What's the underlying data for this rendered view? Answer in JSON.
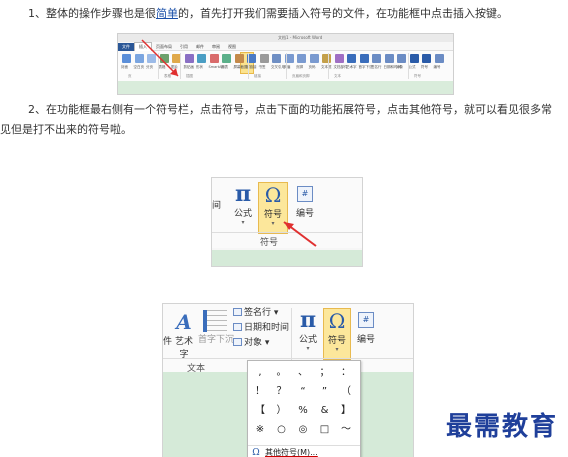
{
  "paragraphs": {
    "p1_before": "1、整体的操作步骤也是很",
    "p1_link": "简单",
    "p1_after": "的，首先打开我们需要插入符号的文件，在功能框中点击插入按键。",
    "p2": "2、在功能框最右侧有一个符号栏，点击符号，点击下面的功能拓展符号，点击其他符号，就可以看见很多常见但是打不出来的符号啦。"
  },
  "shot1": {
    "window_title": "文档1 - Microsoft Word",
    "file_tab": "文件",
    "tabs": [
      "插入",
      "页面布局",
      "引用",
      "邮件",
      "审阅",
      "视图"
    ],
    "active_tab": "插入",
    "ribbon_labels": [
      "封面",
      "空白页",
      "分页",
      "表格",
      "图片",
      "剪贴画",
      "形状",
      "SmartArt",
      "图表",
      "屏幕截图",
      "超链接",
      "书签",
      "交叉引用",
      "页眉",
      "页脚",
      "页码",
      "文本框",
      "文档部件",
      "艺术字",
      "首字下沉",
      "签名行",
      "日期和时间",
      "对象",
      "公式",
      "符号",
      "编号"
    ],
    "groups": [
      "页",
      "表格",
      "插图",
      "链接",
      "页眉和页脚",
      "文本",
      "符号"
    ],
    "highlight_color": "#fbe38e",
    "arrow_color": "#e03030"
  },
  "shot2": {
    "cut_label": "间",
    "formula_glyph": "π",
    "formula_label": "公式",
    "symbol_glyph": "Ω",
    "symbol_label": "符号",
    "number_glyph": "#",
    "number_label": "编号",
    "caret": "▾",
    "group_label": "符号"
  },
  "shot3": {
    "cut_label": "件",
    "art_glyph": "A",
    "art_label": "艺术字",
    "dropcap_label": "首字下沉",
    "cmd_signature": "签名行",
    "cmd_datetime": "日期和时间",
    "cmd_object": "对象",
    "cmd_caret": "▾",
    "formula_glyph": "π",
    "formula_label": "公式",
    "symbol_glyph": "Ω",
    "symbol_label": "符号",
    "number_glyph": "#",
    "number_label": "编号",
    "caret": "▾",
    "group_label": "文本",
    "symbols": [
      ",",
      "。",
      "、",
      "；",
      "：",
      "！",
      "？",
      "“",
      "”",
      "（",
      "【",
      "）",
      "%",
      "&",
      "】",
      "※",
      "○",
      "◎",
      "□",
      "～"
    ],
    "more_icon": "Ω",
    "more_label": "其他符号(M)..."
  },
  "watermark": "最需教育"
}
